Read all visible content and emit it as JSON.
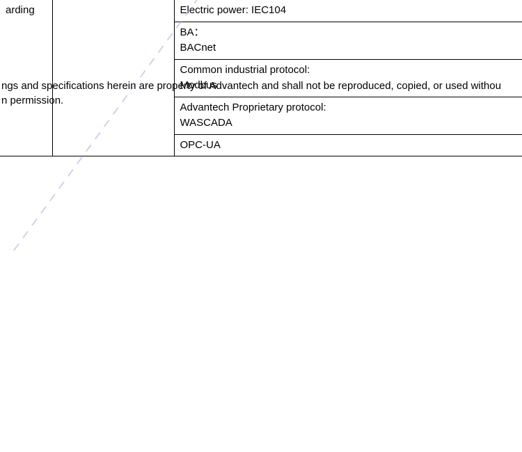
{
  "table": {
    "col1_label": "arding",
    "rows": [
      {
        "text": "Electric power: IEC104"
      },
      {
        "text": "BA：\nBACnet"
      },
      {
        "text": "Common industrial protocol:\nModbus"
      },
      {
        "text": "Advantech Proprietary protocol:\nWASCADA"
      },
      {
        "text": "OPC-UA"
      }
    ]
  },
  "footer": {
    "line1": "ngs and specifications herein are property of Advantech and shall not be reproduced, copied, or used withou",
    "line2": "n permission."
  }
}
